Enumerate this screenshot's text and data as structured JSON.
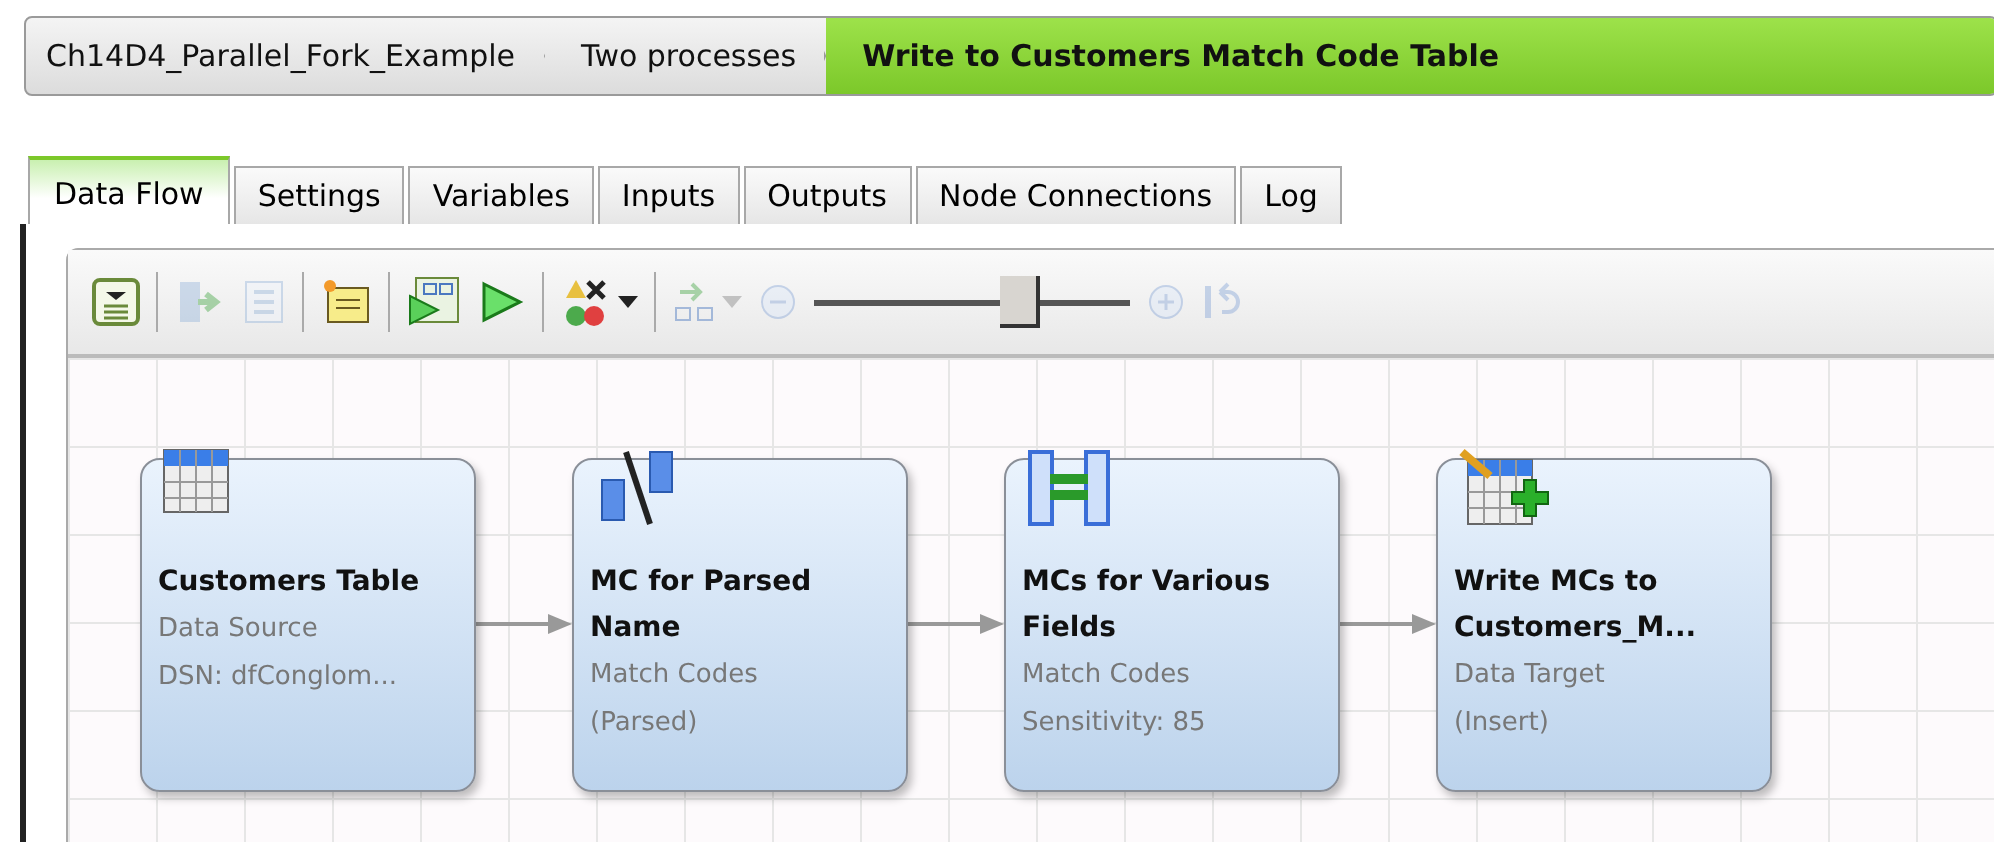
{
  "breadcrumb": [
    {
      "label": "Ch14D4_Parallel_Fork_Example",
      "selected": false
    },
    {
      "label": "Two processes",
      "selected": false
    },
    {
      "label": "Write to Customers Match Code Table",
      "selected": true
    }
  ],
  "tabs": [
    {
      "label": "Data Flow",
      "selected": true
    },
    {
      "label": "Settings",
      "selected": false
    },
    {
      "label": "Variables",
      "selected": false
    },
    {
      "label": "Inputs",
      "selected": false
    },
    {
      "label": "Outputs",
      "selected": false
    },
    {
      "label": "Node Connections",
      "selected": false
    },
    {
      "label": "Log",
      "selected": false
    }
  ],
  "toolbar": [
    {
      "kind": "details",
      "disabled": false
    },
    {
      "kind": "sep"
    },
    {
      "kind": "export",
      "disabled": true
    },
    {
      "kind": "list",
      "disabled": true
    },
    {
      "kind": "sep"
    },
    {
      "kind": "note",
      "disabled": false
    },
    {
      "kind": "sep"
    },
    {
      "kind": "runstep",
      "disabled": false
    },
    {
      "kind": "run",
      "disabled": false
    },
    {
      "kind": "sep"
    },
    {
      "kind": "validate",
      "disabled": false
    },
    {
      "kind": "sep"
    },
    {
      "kind": "layout",
      "disabled": true
    }
  ],
  "zoom": {
    "level": 0.65
  },
  "nodes": [
    {
      "kind": "table",
      "title": "Customers Table",
      "type": "Data Source",
      "detail": "DSN: dfConglom..."
    },
    {
      "kind": "parse",
      "title": "MC for Parsed Name",
      "type": "Match Codes",
      "detail": "(Parsed)"
    },
    {
      "kind": "match",
      "title": "MCs for Various Fields",
      "type": "Match Codes",
      "detail": "Sensitivity: 85"
    },
    {
      "kind": "target",
      "title": "Write MCs to Customers_M...",
      "type": "Data Target",
      "detail": "(Insert)"
    }
  ]
}
